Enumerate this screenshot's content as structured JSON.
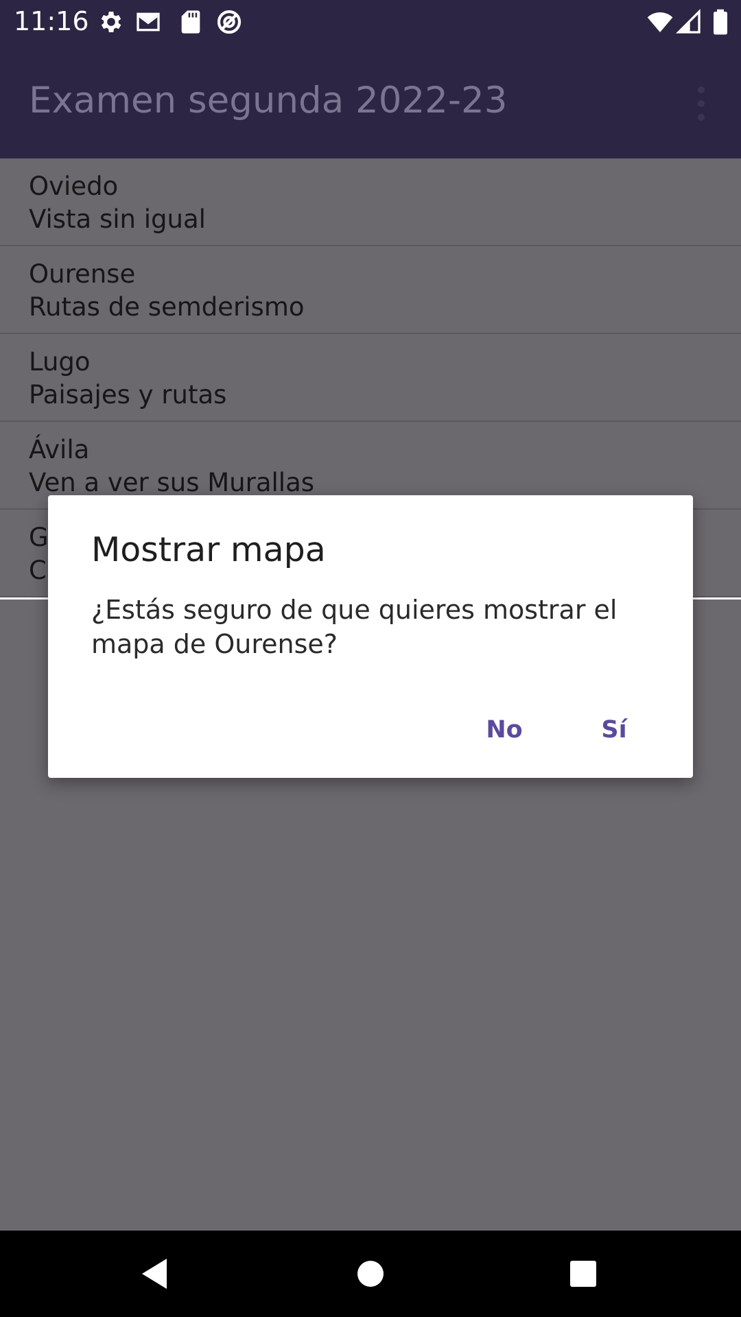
{
  "status_bar": {
    "time": "11:16",
    "left_icons": [
      "gear-icon",
      "gmail-icon",
      "sd-card-icon",
      "no-signal-circle-icon"
    ],
    "right_icons": [
      "wifi-icon",
      "cell-signal-icon",
      "battery-icon"
    ]
  },
  "app_bar": {
    "title": "Examen segunda 2022-23",
    "overflow_icon": "more-vert-icon"
  },
  "list": {
    "items": [
      {
        "title": "Oviedo",
        "subtitle": "Vista sin igual"
      },
      {
        "title": "Ourense",
        "subtitle": "Rutas de semderismo"
      },
      {
        "title": "Lugo",
        "subtitle": "Paisajes y rutas"
      },
      {
        "title": "Ávila",
        "subtitle": "Ven a ver sus Murallas"
      },
      {
        "title": "G",
        "subtitle": "C"
      }
    ]
  },
  "dialog": {
    "title": "Mostrar mapa",
    "message": "¿Estás seguro de que quieres mostrar el mapa de Ourense?",
    "negative_label": "No",
    "positive_label": "Sí"
  },
  "nav_bar": {
    "icons": [
      "back-icon",
      "home-icon",
      "recents-icon"
    ]
  },
  "colors": {
    "app_bar": "#2c2543",
    "scrim_list": "#6b686e",
    "dialog_button": "#5b4a9e",
    "nav_bar": "#000000"
  }
}
